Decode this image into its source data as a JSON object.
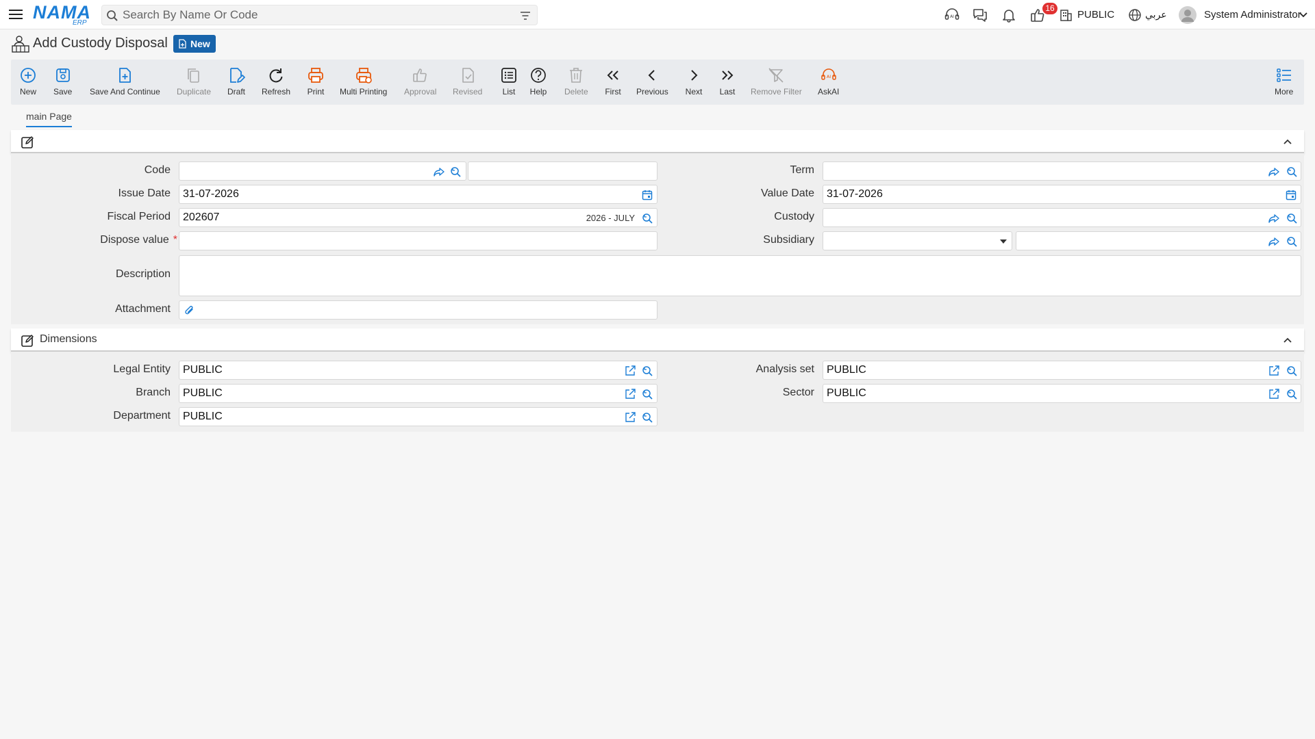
{
  "app": {
    "logo_text": "NAMA",
    "logo_sub": "ERP"
  },
  "search": {
    "placeholder": "Search By Name Or Code"
  },
  "header": {
    "notification_count": "16",
    "org": "PUBLIC",
    "language": "عربي",
    "user": "System Administrator"
  },
  "page": {
    "title": "Add Custody Disposal",
    "status": "New"
  },
  "toolbar": {
    "new": "New",
    "save": "Save",
    "save_continue": "Save And Continue",
    "duplicate": "Duplicate",
    "draft": "Draft",
    "refresh": "Refresh",
    "print": "Print",
    "multi_printing": "Multi Printing",
    "approval": "Approval",
    "revised": "Revised",
    "list": "List",
    "help": "Help",
    "delete": "Delete",
    "first": "First",
    "previous": "Previous",
    "next": "Next",
    "last": "Last",
    "remove_filter": "Remove Filter",
    "askai": "AskAI",
    "more": "More"
  },
  "tabs": {
    "main": "main Page"
  },
  "form": {
    "code_label": "Code",
    "code_value": "",
    "code_name": "",
    "term_label": "Term",
    "term_value": "",
    "issue_date_label": "Issue Date",
    "issue_date_value": "31-07-2026",
    "value_date_label": "Value Date",
    "value_date_value": "31-07-2026",
    "fiscal_period_label": "Fiscal Period",
    "fiscal_period_value": "202607",
    "fiscal_period_name": "2026 - JULY",
    "custody_label": "Custody",
    "custody_value": "",
    "dispose_value_label": "Dispose value",
    "required_mark": "*",
    "dispose_value": "",
    "subsidiary_label": "Subsidiary",
    "subsidiary_type": "",
    "subsidiary_value": "",
    "description_label": "Description",
    "description_value": "",
    "attachment_label": "Attachment"
  },
  "dimensions": {
    "title": "Dimensions",
    "legal_entity_label": "Legal Entity",
    "legal_entity_value": "PUBLIC",
    "analysis_set_label": "Analysis set",
    "analysis_set_value": "PUBLIC",
    "branch_label": "Branch",
    "branch_value": "PUBLIC",
    "sector_label": "Sector",
    "sector_value": "PUBLIC",
    "department_label": "Department",
    "department_value": "PUBLIC"
  },
  "colors": {
    "accent": "#1c7ed6",
    "orange": "#e8590c",
    "badge": "#e03131",
    "status": "#1864ab"
  }
}
